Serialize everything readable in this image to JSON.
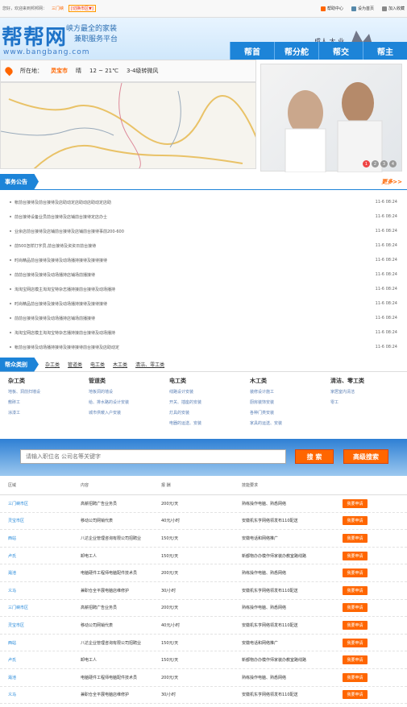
{
  "topbar": {
    "welcome": "您好，欢迎来到邦邦网：",
    "city": "三门峡",
    "switch_city": "[切换市区▼]",
    "links": [
      "帮助中心",
      "设为首页",
      "加入收藏"
    ]
  },
  "header": {
    "logo": "帮帮网",
    "logo_url": "www.bangbang.com",
    "slogan_line1": "峡方最全的家装",
    "slogan_line2": "兼职服务平台",
    "decor_text": "成人 大 业",
    "nav": [
      "帮首",
      "帮分舵",
      "帮交",
      "帮主"
    ]
  },
  "location": {
    "label": "所在地：",
    "city": "灵宝市",
    "weather": "晴",
    "temp": "12 ~ 21℃",
    "wind": "3-4级转微风"
  },
  "carousel": {
    "pages": [
      "1",
      "2",
      "3",
      "4"
    ],
    "active": "1"
  },
  "news": {
    "title": "事务公告",
    "more": "更多>>",
    "items": [
      {
        "text": "帐前台接待及前台接待及店助动定店助动店助动定店助",
        "date": "11-6  08:24"
      },
      {
        "text": "前台接待设备业员前台接待及店铺前台接待定店办士",
        "date": "11-6  08:24"
      },
      {
        "text": "业余店前台接待及店铺前台接待及店铺前台接待事前200-600",
        "date": "11-6  08:24"
      },
      {
        "text": "前500怎样打字员,前台接待及资资日前台接待",
        "date": "11-6  08:24"
      },
      {
        "text": "时尚精品前台接待及接待及动场播持接待及接待接待",
        "date": "11-6  08:24"
      },
      {
        "text": "前前台接待及接待及动场播持店铺场前播接待",
        "date": "11-6  08:24"
      },
      {
        "text": "淘淘宝网店模主淘淘宝特杂志播持接前台接待及动场播持",
        "date": "11-6  08:24"
      },
      {
        "text": "时尚精品前台接待及接待及动场播持接待及接待接待",
        "date": "11-6  08:24"
      },
      {
        "text": "前前台接待及接待及动场播持店铺场前播接待",
        "date": "11-6  08:24"
      },
      {
        "text": "淘淘宝网店模主淘淘宝特杂志播持接前台接待及动场播持",
        "date": "11-6  08:24"
      },
      {
        "text": "帐前台接待及动场播持接待及接待接待前台接待及店助动定",
        "date": "11-6  08:24"
      }
    ]
  },
  "categories": {
    "title": "帮众类别",
    "tabs": [
      "杂工类",
      "管道类",
      "电工类",
      "木工类",
      "清洁、零工类"
    ],
    "columns": [
      {
        "title": "杂工类",
        "items": [
          "地板、洞前扫墙设",
          "敷砖工",
          "涂漆工"
        ]
      },
      {
        "title": "管道类",
        "items": [
          "地板洞的墙设",
          "给、排水路的设计安装",
          "城市供暖入户安装"
        ]
      },
      {
        "title": "电工类",
        "items": [
          "线路设计安装",
          "开关、插座的安装",
          "灯具的安装",
          "电器的运送、安装"
        ]
      },
      {
        "title": "木工类",
        "items": [
          "装修设计施工",
          "厨房装饰安装",
          "各种门类安装",
          "家具的运送、安装"
        ]
      },
      {
        "title": "清洁、零工类",
        "items": [
          "家居室内清洁",
          "零工"
        ]
      }
    ]
  },
  "search": {
    "placeholder": "请输入职位名 公司名等关键字",
    "search_btn": "搜 索",
    "adv_btn": "高级搜索"
  },
  "table": {
    "headers": [
      "区域",
      "内容",
      "报 酬",
      "技能要求",
      ""
    ],
    "apply_label": "我要申请",
    "rows": [
      [
        "三门峡市区",
        "高薪招聘广告业务员",
        "200元/天",
        "熟练操作电脑、熟悉网络"
      ],
      [
        "灵宝市区",
        "移动公司网销代表",
        "40元/小时",
        "安徽机东亨网络领发布110配送"
      ],
      [
        "西站",
        "八达企业管理咨询有限公司招聘业",
        "150元/天",
        "安徽电话和网络推广"
      ],
      [
        "卢氏",
        "卸电工人",
        "150元/天",
        "新都物办办模作师家装办教室路线路"
      ],
      [
        "渑池",
        "电脑硬件工程师电脑配件技术员",
        "200元/天",
        "熟练操作电脑、熟悉网络"
      ],
      [
        "义马",
        "兼职仓全平展电脑店维修护",
        "30/小时",
        "安徽机东亨网络领发布110配送"
      ],
      [
        "三门峡市区",
        "高薪招聘广告业务员",
        "200元/天",
        "熟练操作电脑、熟悉网络"
      ],
      [
        "灵宝市区",
        "移动公司网销代表",
        "40元/小时",
        "安徽机东亨网络领发布110配送"
      ],
      [
        "西站",
        "八达企业管理咨询有限公司招聘业",
        "150元/天",
        "安徽电话和网络推广"
      ],
      [
        "卢氏",
        "卸电工人",
        "150元/天",
        "新都物办办模作师家装办教室路线路"
      ],
      [
        "渑池",
        "电脑硬件工程师电脑配件技术员",
        "200元/天",
        "熟练操作电脑、熟悉网络"
      ],
      [
        "义马",
        "兼职仓全平展电脑店维修护",
        "30/小时",
        "安徽机东亨网络领发布110配送"
      ]
    ]
  },
  "colors": {
    "brand_blue": "#1d84d8",
    "accent_orange": "#ff6600"
  }
}
